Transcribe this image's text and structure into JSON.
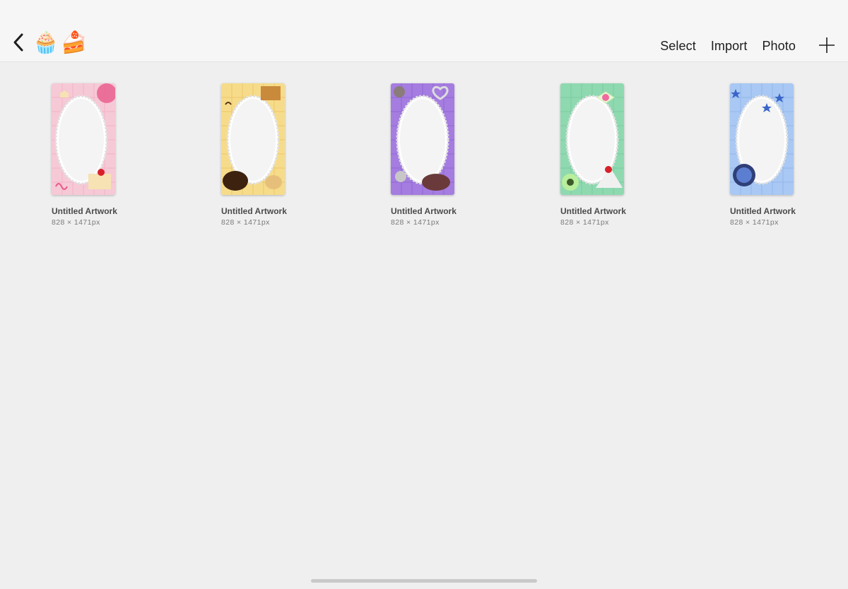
{
  "header": {
    "emojis": [
      "🧁",
      "🍰"
    ],
    "actions": [
      "Select",
      "Import",
      "Photo"
    ]
  },
  "artworks": [
    {
      "title": "Untitled Artwork",
      "size": "828 × 1471px",
      "theme": "pink",
      "bg": "#f6c9d6",
      "accent": "#e85a8a"
    },
    {
      "title": "Untitled Artwork",
      "size": "828 × 1471px",
      "theme": "yellow",
      "bg": "#f6dc8a",
      "accent": "#8a5a1e"
    },
    {
      "title": "Untitled Artwork",
      "size": "828 × 1471px",
      "theme": "purple",
      "bg": "#a57ce0",
      "accent": "#6e46c4"
    },
    {
      "title": "Untitled Artwork",
      "size": "828 × 1471px",
      "theme": "mint",
      "bg": "#8fd9b0",
      "accent": "#3fae72"
    },
    {
      "title": "Untitled Artwork",
      "size": "828 × 1471px",
      "theme": "blue",
      "bg": "#a9c8f3",
      "accent": "#3a66c8"
    }
  ]
}
